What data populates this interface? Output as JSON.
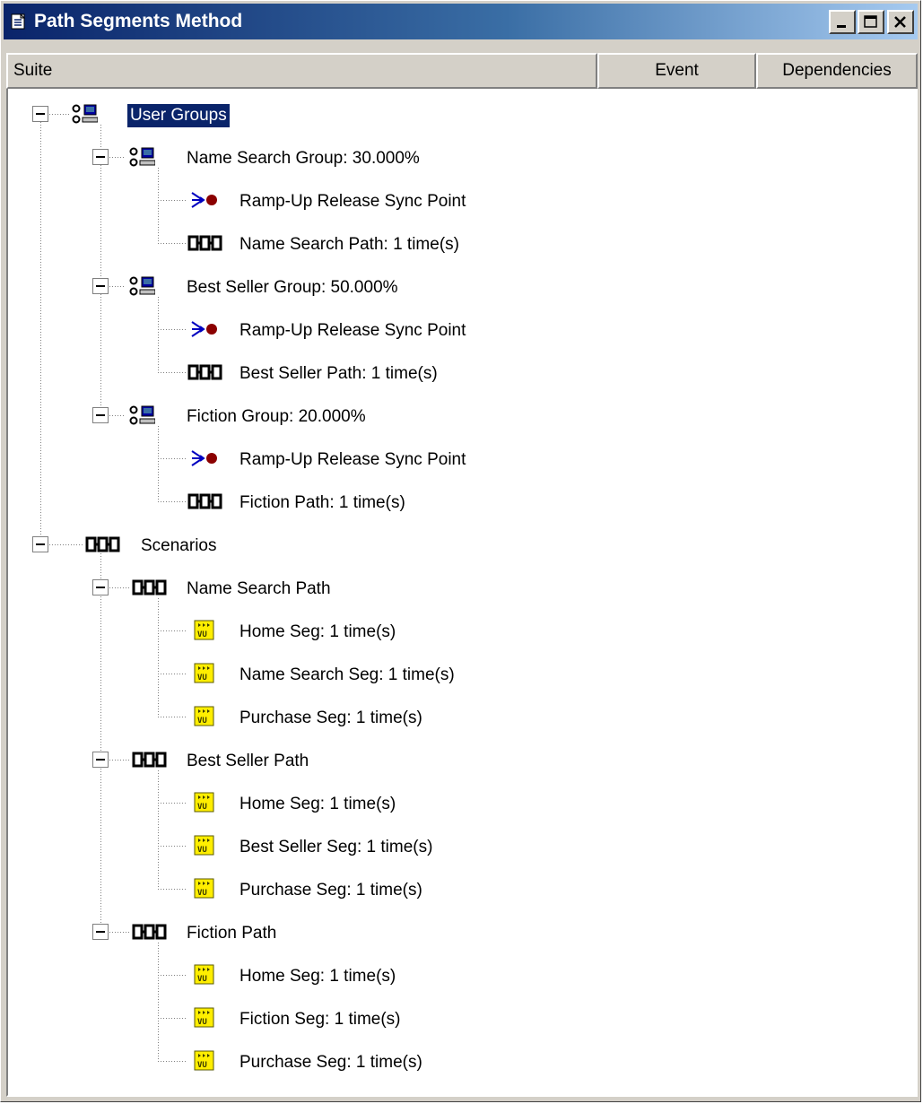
{
  "window": {
    "title": "Path Segments Method",
    "buttons": [
      "minimize-icon",
      "maximize-icon",
      "close-icon"
    ]
  },
  "columns": {
    "suite": "Suite",
    "event": "Event",
    "dependencies": "Dependencies"
  },
  "colors": {
    "title_gradient_start": "#0a246a",
    "title_gradient_end": "#a6caf0",
    "selection": "#0a246a",
    "sync_point": "#8b0000",
    "segment_icon_fill": "#ffee00"
  },
  "tree": {
    "user_groups": {
      "label": "User Groups",
      "selected": true,
      "icon": "user-group-icon",
      "groups": [
        {
          "label": "Name Search Group: 30.000%",
          "sync": "Ramp-Up Release Sync Point",
          "path": "Name Search Path: 1 time(s)"
        },
        {
          "label": "Best Seller Group: 50.000%",
          "sync": "Ramp-Up Release Sync Point",
          "path": "Best Seller Path: 1 time(s)"
        },
        {
          "label": "Fiction Group: 20.000%",
          "sync": "Ramp-Up Release Sync Point",
          "path": "Fiction Path: 1 time(s)"
        }
      ]
    },
    "scenarios": {
      "label": "Scenarios",
      "icon": "scenario-icon",
      "paths": [
        {
          "label": "Name Search Path",
          "segments": [
            "Home Seg: 1 time(s)",
            "Name Search Seg: 1 time(s)",
            "Purchase Seg: 1 time(s)"
          ]
        },
        {
          "label": "Best Seller Path",
          "segments": [
            "Home Seg: 1 time(s)",
            "Best Seller Seg: 1 time(s)",
            "Purchase Seg: 1 time(s)"
          ]
        },
        {
          "label": "Fiction Path",
          "segments": [
            "Home Seg: 1 time(s)",
            "Fiction Seg: 1 time(s)",
            "Purchase Seg: 1 time(s)"
          ]
        }
      ]
    }
  }
}
